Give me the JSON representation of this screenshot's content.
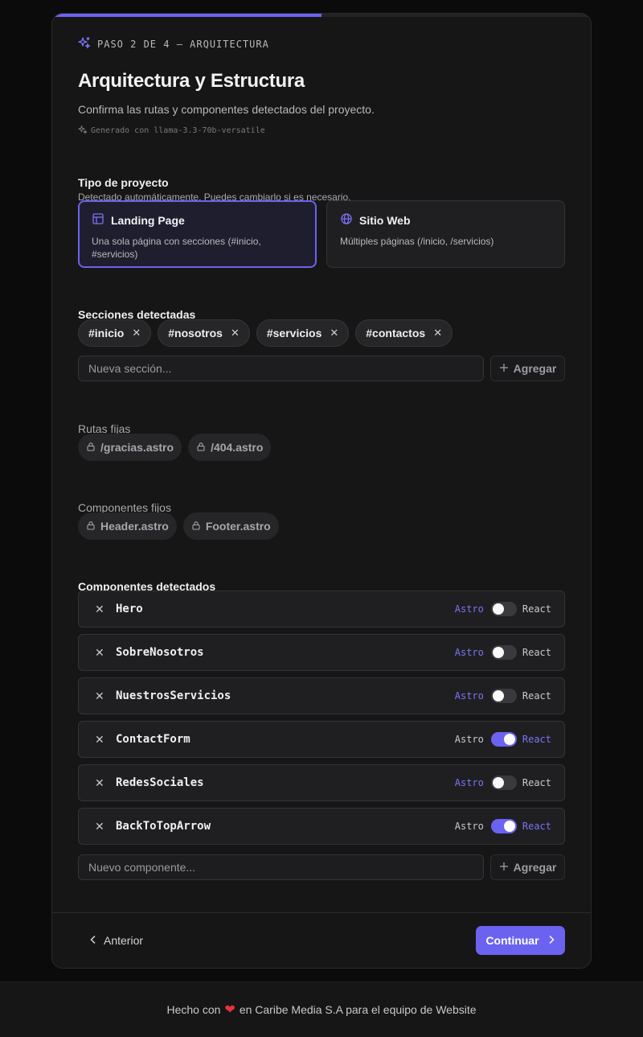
{
  "progress": {
    "fraction": 0.5
  },
  "header": {
    "step": "PASO 2 DE 4 — ARQUITECTURA",
    "title": "Arquitectura y Estructura",
    "subtitle": "Confirma las rutas y componentes detectados del proyecto.",
    "generated": "Generado con llama-3.3-70b-versatile"
  },
  "project_type": {
    "heading": "Tipo de proyecto",
    "subheading": "Detectado automáticamente. Puedes cambiarlo si es necesario.",
    "options": [
      {
        "label": "Landing Page",
        "desc": "Una sola página con secciones (#inicio, #servicios)",
        "icon": "layout-icon",
        "selected": true
      },
      {
        "label": "Sitio Web",
        "desc": "Múltiples páginas (/inicio, /servicios)",
        "icon": "globe-icon",
        "selected": false
      }
    ]
  },
  "sections": {
    "heading": "Secciones detectadas",
    "items": [
      "#inicio",
      "#nosotros",
      "#servicios",
      "#contactos"
    ],
    "remove_glyph": "✕",
    "input_placeholder": "Nueva sección...",
    "add_label": "Agregar"
  },
  "fixed_routes": {
    "heading": "Rutas fijas",
    "items": [
      "/gracias.astro",
      "/404.astro"
    ]
  },
  "fixed_components": {
    "heading": "Componentes fijos",
    "items": [
      "Header.astro",
      "Footer.astro"
    ]
  },
  "detected_components": {
    "heading": "Componentes detectados",
    "framework_left": "Astro",
    "framework_right": "React",
    "items": [
      {
        "name": "Hero",
        "react": false
      },
      {
        "name": "SobreNosotros",
        "react": false
      },
      {
        "name": "NuestrosServicios",
        "react": false
      },
      {
        "name": "ContactForm",
        "react": true
      },
      {
        "name": "RedesSociales",
        "react": false
      },
      {
        "name": "BackToTopArrow",
        "react": true
      }
    ],
    "input_placeholder": "Nuevo componente...",
    "add_label": "Agregar"
  },
  "nav": {
    "prev_label": "Anterior",
    "next_label": "Continuar"
  },
  "footer": {
    "prefix": "Hecho con",
    "suffix": "en Caribe Media S.A para el equipo de Website"
  },
  "colors": {
    "accent": "#6b63f0",
    "heart": "#e5333b",
    "background": "#0b0b0b",
    "card": "#161616"
  }
}
